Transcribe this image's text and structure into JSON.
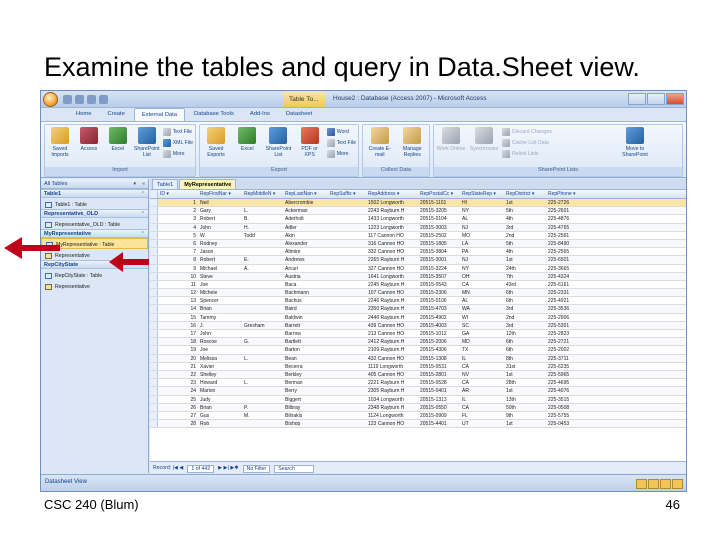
{
  "slide": {
    "title": "Examine the tables and query in Data.Sheet view.",
    "footer_left": "CSC 240 (Blum)",
    "page_number": "46"
  },
  "window": {
    "context_tab": "Table To...",
    "title": "House2 : Database (Access 2007) - Microsoft Access"
  },
  "ribbon": {
    "tabs": [
      "Home",
      "Create",
      "External Data",
      "Database Tools",
      "Add-Ins",
      "Datasheet"
    ],
    "active_tab": "External Data",
    "groups": {
      "import": {
        "label": "Import",
        "big": [
          "Saved Imports",
          "Access",
          "Excel",
          "SharePoint List"
        ],
        "small": [
          "Text File",
          "XML File",
          "More"
        ]
      },
      "export": {
        "label": "Export",
        "big": [
          "Saved Exports",
          "Excel",
          "SharePoint List",
          "PDF or XPS"
        ],
        "small": [
          "Word",
          "Text File",
          "More"
        ]
      },
      "collect": {
        "label": "Collect Data",
        "big": [
          "Create E-mail",
          "Manage Replies"
        ]
      },
      "sharepoint": {
        "label": "SharePoint Lists",
        "big": [
          "Work Online",
          "Synchronize"
        ],
        "small": [
          "Discard Changes",
          "Cache List Data",
          "Relink Lists"
        ],
        "move": "Move to SharePoint"
      }
    }
  },
  "nav_pane": {
    "header": "All Tables",
    "groups": [
      {
        "name": "Table1",
        "items": [
          {
            "label": "Table1 : Table",
            "kind": "table"
          }
        ]
      },
      {
        "name": "Representative_OLD",
        "items": [
          {
            "label": "Representative_OLD : Table",
            "kind": "table"
          }
        ]
      },
      {
        "name": "MyRepresentative",
        "items": [
          {
            "label": "MyRepresentative : Table",
            "kind": "table",
            "selected": true
          },
          {
            "label": "Representative",
            "kind": "query"
          }
        ]
      },
      {
        "name": "RepCityState",
        "items": [
          {
            "label": "RepCityState : Table",
            "kind": "table"
          },
          {
            "label": "Representative",
            "kind": "query"
          }
        ]
      }
    ]
  },
  "doc_tabs": [
    "Table1",
    "MyRepresentative"
  ],
  "active_doc_tab": "MyRepresentative",
  "datasheet": {
    "columns": [
      "ID",
      "RepFirstNar",
      "RepMiddleN",
      "RepLastNan",
      "RepSuffix",
      "RepAddress",
      "RepPostalCc",
      "RepStateRep",
      "RepDistrict",
      "RepPhone"
    ],
    "rows": [
      [
        "1",
        "Neil",
        "",
        "Abercrombie",
        "",
        "1502 Longworth",
        "20515-1101",
        "HI",
        "1st",
        "225-2726"
      ],
      [
        "2",
        "Gary",
        "L.",
        "Ackerman",
        "",
        "2243 Rayburn H",
        "20515-3205",
        "NY",
        "5th",
        "225-2601"
      ],
      [
        "3",
        "Robert",
        "B.",
        "Aderholt",
        "",
        "1433 Longworth",
        "20515-0104",
        "AL",
        "4th",
        "225-4876"
      ],
      [
        "4",
        "John",
        "H.",
        "Adler",
        "",
        "1223 Longworth",
        "20515-3003",
        "NJ",
        "3rd",
        "225-4765"
      ],
      [
        "5",
        "W.",
        "Todd",
        "Akin",
        "",
        "117 Cannon HO",
        "20515-2502",
        "MO",
        "2nd",
        "225-2561"
      ],
      [
        "6",
        "Rodney",
        "",
        "Alexander",
        "",
        "316 Cannon HO",
        "20515-1805",
        "LA",
        "5th",
        "225-8490"
      ],
      [
        "7",
        "Jason",
        "",
        "Altmire",
        "",
        "332 Cannon HO",
        "20515-3804",
        "PA",
        "4th",
        "225-2565"
      ],
      [
        "8",
        "Robert",
        "E.",
        "Andrews",
        "",
        "2265 Rayburn H",
        "20515-3001",
        "NJ",
        "1st",
        "225-6501"
      ],
      [
        "9",
        "Michael",
        "A.",
        "Arcuri",
        "",
        "327 Cannon HO",
        "20515-3224",
        "NY",
        "24th",
        "225-3665"
      ],
      [
        "10",
        "Steve",
        "",
        "Austria",
        "",
        "1641 Longworth",
        "20515-3507",
        "OH",
        "7th",
        "225-4324"
      ],
      [
        "11",
        "Joe",
        "",
        "Baca",
        "",
        "2245 Rayburn H",
        "20515-0543",
        "CA",
        "43rd",
        "225-6161"
      ],
      [
        "12",
        "Michele",
        "",
        "Bachmann",
        "",
        "107 Cannon HO",
        "20515-2306",
        "MN",
        "6th",
        "225-2331"
      ],
      [
        "13",
        "Spencer",
        "",
        "Bachus",
        "",
        "2246 Rayburn H",
        "20515-0106",
        "AL",
        "6th",
        "225-4921"
      ],
      [
        "14",
        "Brian",
        "",
        "Baird",
        "",
        "2350 Rayburn H",
        "20515-4703",
        "WA",
        "3rd",
        "225-3536"
      ],
      [
        "15",
        "Tammy",
        "",
        "Baldwin",
        "",
        "2446 Rayburn H",
        "20515-4902",
        "WI",
        "2nd",
        "225-2906"
      ],
      [
        "16",
        "J.",
        "Gresham",
        "Barrett",
        "",
        "439 Cannon HO",
        "20515-4003",
        "SC",
        "3rd",
        "225-5301"
      ],
      [
        "17",
        "John",
        "",
        "Barrow",
        "",
        "213 Cannon HO",
        "20515-1012",
        "GA",
        "12th",
        "225-2823"
      ],
      [
        "18",
        "Roscoe",
        "G.",
        "Bartlett",
        "",
        "2412 Rayburn H",
        "20515-2006",
        "MD",
        "6th",
        "225-2721"
      ],
      [
        "19",
        "Joe",
        "",
        "Barton",
        "",
        "2109 Rayburn H",
        "20515-4306",
        "TX",
        "6th",
        "225-2002"
      ],
      [
        "20",
        "Melissa",
        "L.",
        "Bean",
        "",
        "432 Cannon HO",
        "20515-1308",
        "IL",
        "8th",
        "225-3711"
      ],
      [
        "21",
        "Xavier",
        "",
        "Becerra",
        "",
        "1119 Longworth",
        "20515-0531",
        "CA",
        "31st",
        "225-6235"
      ],
      [
        "22",
        "Shelley",
        "",
        "Berkley",
        "",
        "405 Cannon HO",
        "20515-2801",
        "NV",
        "1st",
        "225-5965"
      ],
      [
        "23",
        "Howard",
        "L.",
        "Berman",
        "",
        "2221 Rayburn H",
        "20515-0528",
        "CA",
        "28th",
        "225-4695"
      ],
      [
        "24",
        "Marion",
        "",
        "Berry",
        "",
        "2305 Rayburn H",
        "20515-0401",
        "AR",
        "1st",
        "225-4076"
      ],
      [
        "25",
        "Judy",
        "",
        "Biggert",
        "",
        "1034 Longworth",
        "20515-1313",
        "IL",
        "13th",
        "225-3515"
      ],
      [
        "26",
        "Brian",
        "P.",
        "Bilbray",
        "",
        "2348 Rayburn H",
        "20515-0550",
        "CA",
        "50th",
        "225-0508"
      ],
      [
        "27",
        "Gus",
        "M.",
        "Bilirakis",
        "",
        "1124 Longworth",
        "20515-0909",
        "FL",
        "9th",
        "225-5755"
      ],
      [
        "28",
        "Rob",
        "",
        "Bishop",
        "",
        "123 Cannon HO",
        "20515-4401",
        "UT",
        "1st",
        "225-0453"
      ]
    ]
  },
  "record_nav": {
    "prefix": "Record: |◀ ◀",
    "position": "1 of 442",
    "suffix": "▶ ▶| ▶✱",
    "filter": "No Filter",
    "search": "Search"
  },
  "status_bar": {
    "text": "Datasheet View"
  },
  "colors": {
    "arrow": "#c0001a",
    "ribbon_text": "#15428b"
  },
  "icons": {
    "arrow": "left-pointing-red-arrow"
  }
}
